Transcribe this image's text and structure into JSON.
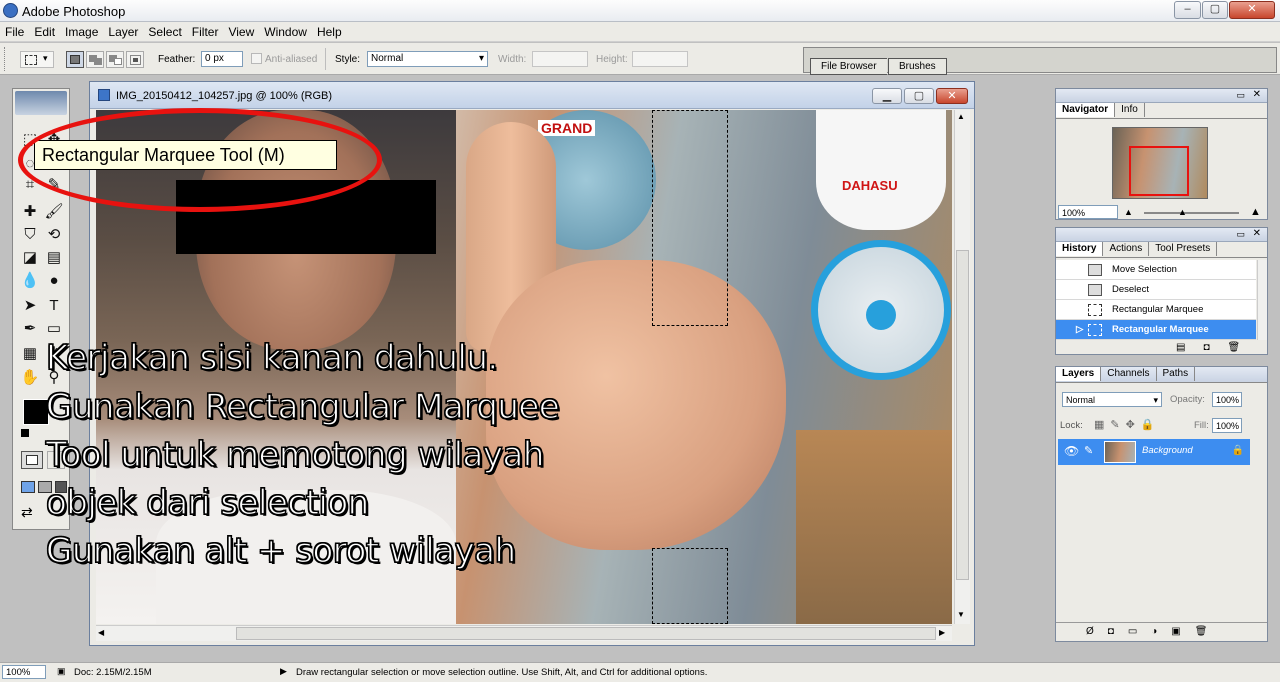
{
  "window": {
    "title": "Adobe Photoshop",
    "minimize": "–",
    "maximize": "▢",
    "close": "✕"
  },
  "menu": [
    "File",
    "Edit",
    "Image",
    "Layer",
    "Select",
    "Filter",
    "View",
    "Window",
    "Help"
  ],
  "options": {
    "feather_label": "Feather:",
    "feather_value": "0 px",
    "antialiased_label": "Anti-aliased",
    "style_label": "Style:",
    "style_value": "Normal",
    "width_label": "Width:",
    "height_label": "Height:"
  },
  "palette_well": {
    "tabs": [
      "File Browser",
      "Brushes"
    ]
  },
  "tooltip": "Rectangular Marquee Tool (M)",
  "document": {
    "title": "IMG_20150412_104257.jpg @ 100% (RGB)"
  },
  "overlay": {
    "lines": [
      "Kerjakan sisi kanan dahulu.",
      "Gunakan Rectangular Marquee",
      "Tool untuk memotong wilayah",
      "objek dari selection",
      "Gunakan alt + sorot wilayah"
    ]
  },
  "photo_text": {
    "sign1": "GRAND",
    "sign2": "DAHASU"
  },
  "navigator": {
    "tabs": [
      "Navigator",
      "Info"
    ],
    "zoom": "100%"
  },
  "history": {
    "tabs": [
      "History",
      "Actions",
      "Tool Presets"
    ],
    "items": [
      "Move Selection",
      "Deselect",
      "Rectangular Marquee",
      "Rectangular Marquee"
    ],
    "selected_index": 3
  },
  "layers": {
    "tabs": [
      "Layers",
      "Channels",
      "Paths"
    ],
    "blend_mode": "Normal",
    "opacity_label": "Opacity:",
    "opacity_value": "100%",
    "lock_label": "Lock:",
    "fill_label": "Fill:",
    "fill_value": "100%",
    "layer_name": "Background"
  },
  "status": {
    "zoom": "100%",
    "doc": "Doc: 2.15M/2.15M",
    "hint": "Draw rectangular selection or move selection outline.  Use Shift, Alt, and Ctrl for additional options."
  },
  "colors": {
    "selection": "#3d8df0",
    "annotation_ring": "#e8120f",
    "title_gradient": "#c3d2e8"
  }
}
